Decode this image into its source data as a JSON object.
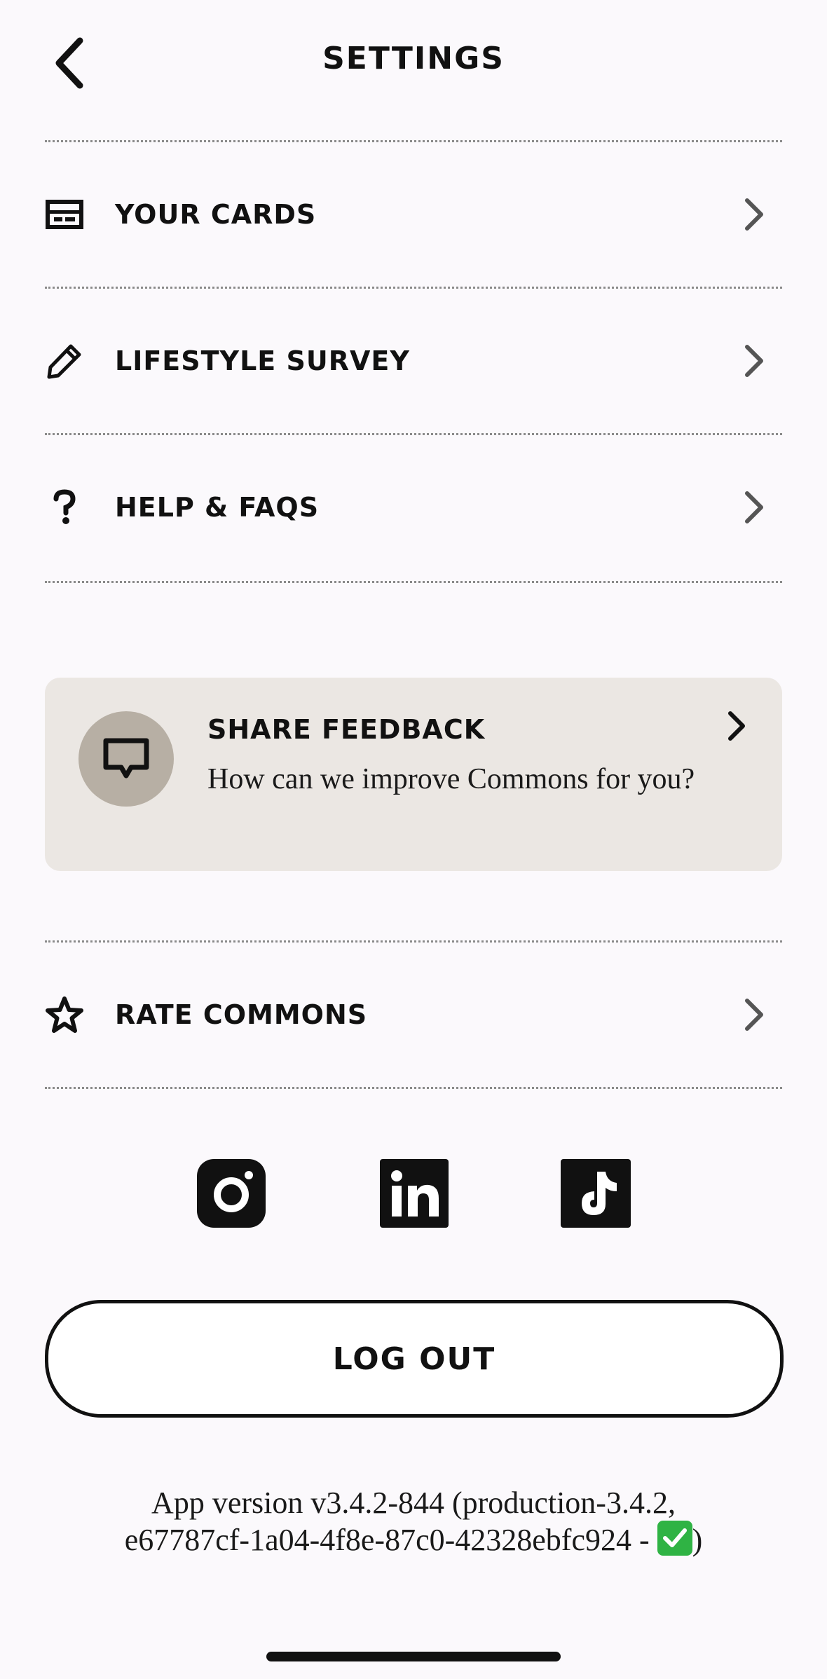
{
  "header": {
    "title": "SETTINGS",
    "back_icon": "chevron-left-icon"
  },
  "menu": {
    "items": [
      {
        "label": "YOUR CARDS",
        "icon": "card-icon"
      },
      {
        "label": "LIFESTYLE SURVEY",
        "icon": "pencil-icon"
      },
      {
        "label": "HELP & FAQS",
        "icon": "question-icon"
      }
    ],
    "rate": {
      "label": "RATE COMMONS",
      "icon": "star-icon"
    }
  },
  "feedback": {
    "title": "SHARE FEEDBACK",
    "subtitle": "How can we improve Commons for you?",
    "icon": "chat-bubble-icon"
  },
  "social": {
    "icons": [
      "instagram-icon",
      "linkedin-icon",
      "tiktok-icon"
    ]
  },
  "logout": {
    "label": "LOG OUT"
  },
  "footer": {
    "version_line1": "App version v3.4.2-844 (production-3.4.2,",
    "version_line2_prefix": "e67787cf-1a04-4f8e-87c0-42328ebfc924 - ",
    "version_line2_suffix": ")"
  },
  "colors": {
    "background": "#fbf9fc",
    "card_bg": "#ebe7e3",
    "feedback_icon_bg": "#b7afa4",
    "text": "#111111",
    "check_green": "#2fb344"
  }
}
